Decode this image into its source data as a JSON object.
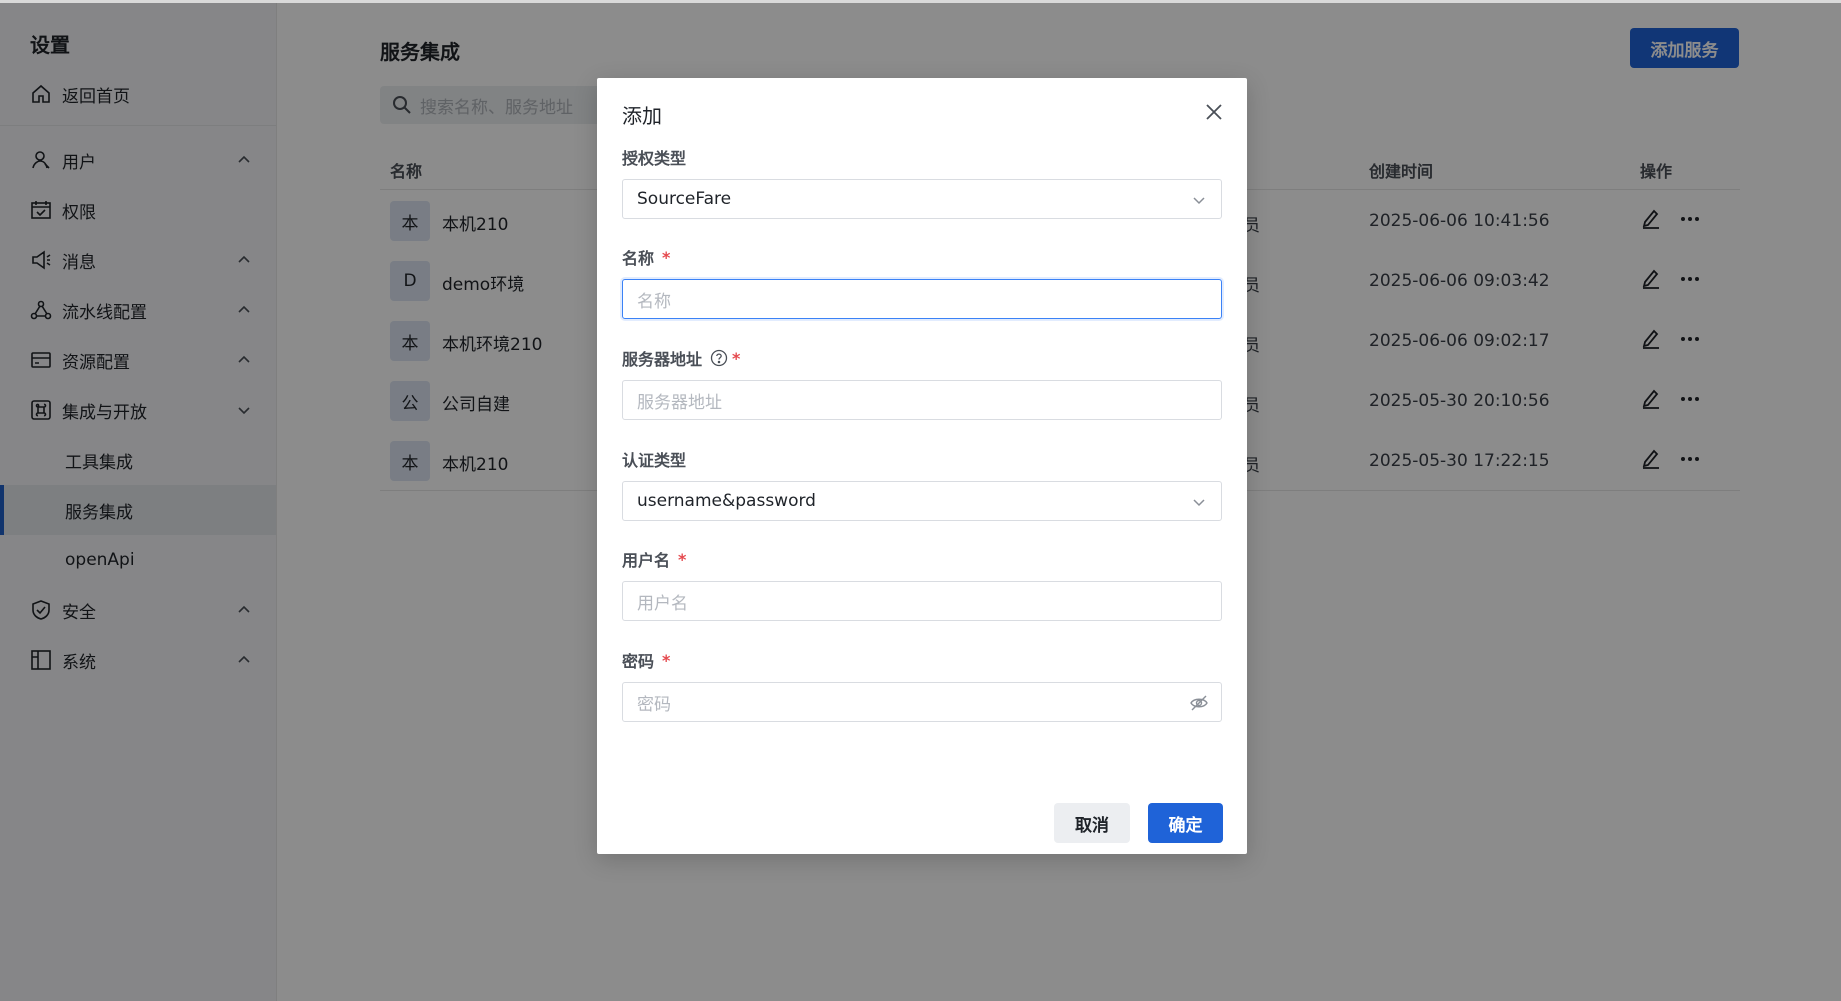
{
  "sidebar": {
    "title": "设置",
    "home": "返回首页",
    "items": [
      {
        "label": "用户",
        "icon": "user-icon"
      },
      {
        "label": "权限",
        "icon": "calendar-check-icon"
      },
      {
        "label": "消息",
        "icon": "megaphone-icon"
      },
      {
        "label": "流水线配置",
        "icon": "pipeline-icon"
      },
      {
        "label": "资源配置",
        "icon": "card-icon"
      },
      {
        "label": "集成与开放",
        "icon": "command-icon"
      },
      {
        "label": "安全",
        "icon": "shield-icon"
      },
      {
        "label": "系统",
        "icon": "layout-icon"
      }
    ],
    "subitems": [
      "工具集成",
      "服务集成",
      "openApi"
    ],
    "active_subitem": "服务集成"
  },
  "main": {
    "title": "服务集成",
    "add_button": "添加服务",
    "search_placeholder": "搜索名称、服务地址",
    "columns": {
      "name": "名称",
      "created": "创建时间",
      "actions": "操作"
    },
    "rows": [
      {
        "avatar": "本",
        "name": "本机210",
        "created": "2025-06-06 10:41:56"
      },
      {
        "avatar": "D",
        "name": "demo环境",
        "created": "2025-06-06 09:03:42"
      },
      {
        "avatar": "本",
        "name": "本机环境210",
        "created": "2025-06-06 09:02:17"
      },
      {
        "avatar": "公",
        "name": "公司自建",
        "created": "2025-05-30 20:10:56"
      },
      {
        "avatar": "本",
        "name": "本机210",
        "created": "2025-05-30 17:22:15"
      }
    ],
    "row_fragment": "员"
  },
  "modal": {
    "title": "添加",
    "auth_type_label": "授权类型",
    "auth_type_value": "SourceFare",
    "name_label": "名称",
    "name_placeholder": "名称",
    "server_label": "服务器地址",
    "server_placeholder": "服务器地址",
    "cred_type_label": "认证类型",
    "cred_type_value": "username&password",
    "username_label": "用户名",
    "username_placeholder": "用户名",
    "password_label": "密码",
    "password_placeholder": "密码",
    "required_mark": "*",
    "cancel": "取消",
    "confirm": "确定"
  },
  "colors": {
    "primary": "#1f63d8",
    "required": "#e5484d",
    "focus": "#3b82f6"
  }
}
